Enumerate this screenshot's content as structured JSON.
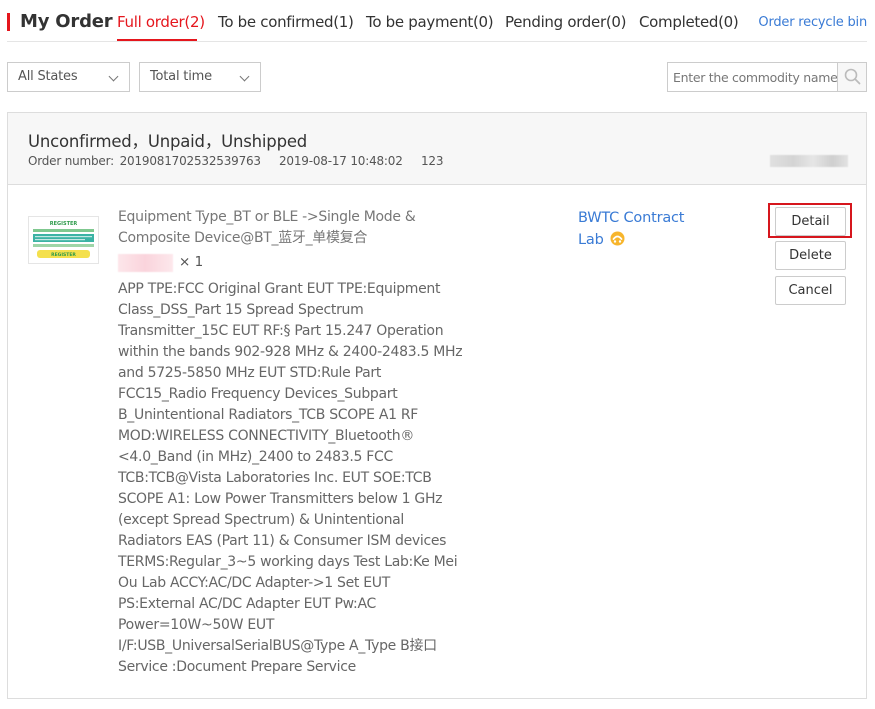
{
  "header": {
    "title": "My Order",
    "tabs": [
      {
        "label": "Full order(2)",
        "active": true
      },
      {
        "label": "To be confirmed(1)",
        "active": false
      },
      {
        "label": "To be payment(0)",
        "active": false
      },
      {
        "label": "Pending order(0)",
        "active": false
      },
      {
        "label": "Completed(0)",
        "active": false
      }
    ],
    "recycle_link": "Order recycle bin"
  },
  "filters": {
    "states": "All States",
    "time": "Total time",
    "search_placeholder": "Enter the commodity name",
    "search_value": ""
  },
  "order": {
    "status": "Unconfirmed，Unpaid，Unshipped",
    "number_label": "Order number:",
    "number": "2019081702532539763",
    "date": "2019-08-17 10:48:02",
    "extra": "123",
    "product": {
      "title": "Equipment Type_BT or BLE ->Single Mode & Composite Device@BT_蓝牙_单模复合",
      "quantity": "× 1",
      "description": "APP TPE:FCC Original Grant EUT TPE:Equipment Class_DSS_Part 15 Spread Spectrum Transmitter_15C EUT RF:§ Part 15.247 Operation within the bands 902-928 MHz & 2400-2483.5 MHz and 5725-5850 MHz EUT STD:Rule Part FCC15_Radio Frequency Devices_Subpart B_Unintentional Radiators_TCB SCOPE A1 RF MOD:WIRELESS CONNECTIVITY_Bluetooth® <4.0_Band (in MHz)_2400 to 2483.5 FCC TCB:TCB@Vista Laboratories Inc. EUT SOE:TCB SCOPE A1: Low Power Transmitters below 1 GHz (except Spread Spectrum) & Unintentional Radiators EAS (Part 11) & Consumer ISM devices TERMS:Regular_3~5 working days Test Lab:Ke Mei Ou Lab ACCY:AC/DC Adapter->1 Set EUT PS:External AC/DC Adapter EUT Pw:AC Power=10W~50W EUT I/F:USB_UniversalSerialBUS@Type A_Type B接口 Service :Document Prepare Service",
      "thumbnail_top": "REGISTER",
      "thumbnail_bottom": "REGISTER"
    },
    "lab_name": "BWTC Contract Lab",
    "lab_icon": "chat-icon",
    "actions": {
      "detail": "Detail",
      "delete": "Delete",
      "cancel": "Cancel"
    }
  },
  "colors": {
    "accent": "#e5161d",
    "link": "#3a7bd5",
    "highlight": "#d6161d"
  }
}
